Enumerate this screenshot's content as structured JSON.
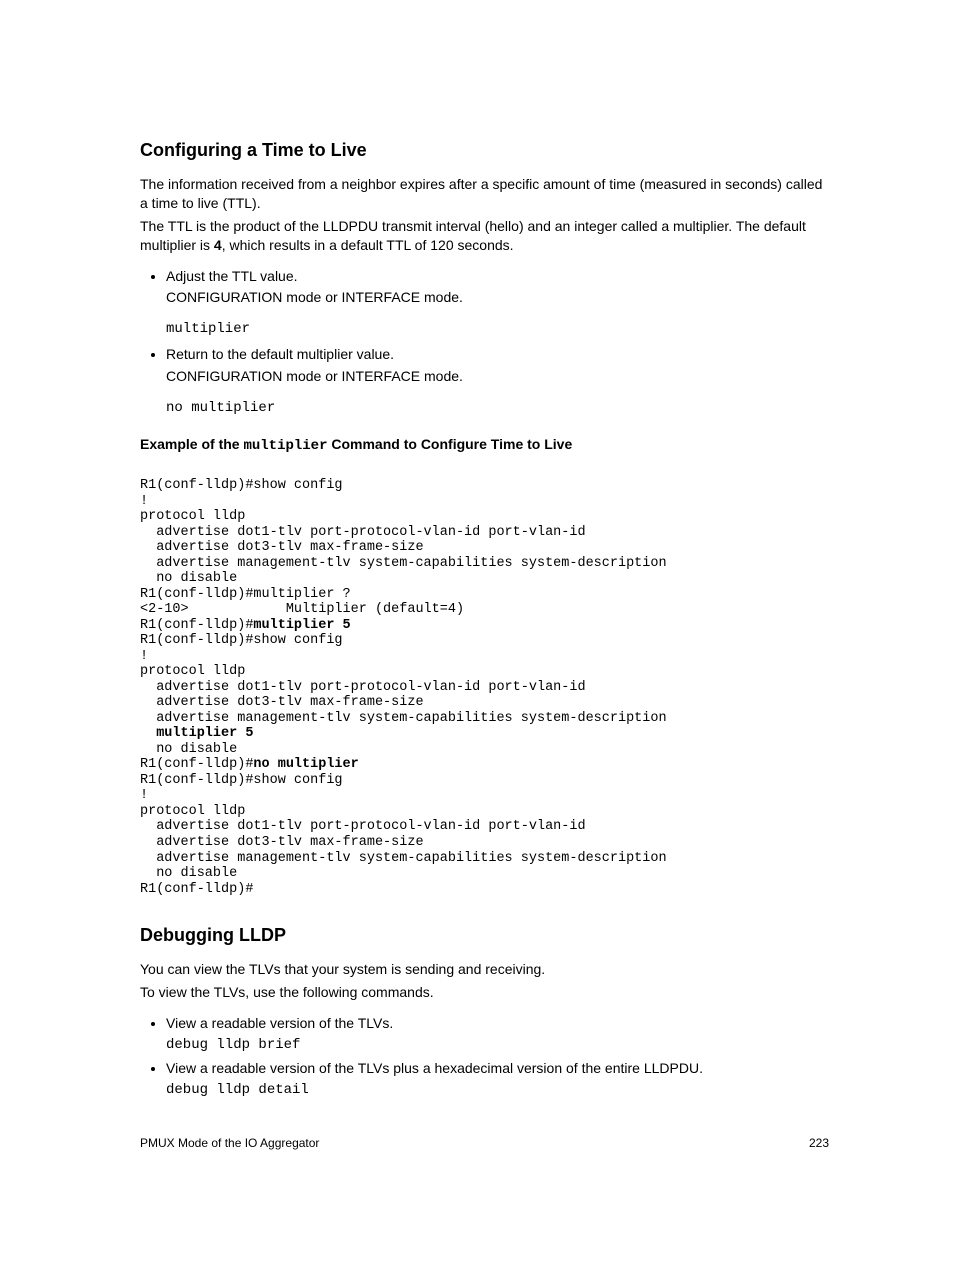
{
  "section1": {
    "heading": "Configuring a Time to Live",
    "p1": "The information received from a neighbor expires after a specific amount of time (measured in seconds) called a time to live (TTL).",
    "p2a": "The TTL is the product of the LLDPDU transmit interval (hello) and an integer called a multiplier. The default multiplier is ",
    "p2bold": "4",
    "p2b": ", which results in a default TTL of 120 seconds.",
    "bullet1": "Adjust the TTL value.",
    "sub1": "CONFIGURATION mode or INTERFACE mode.",
    "code1": "multiplier",
    "bullet2": "Return to the default multiplier value.",
    "sub2": "CONFIGURATION mode or INTERFACE mode.",
    "code2": "no multiplier",
    "example_label_a": "Example of the ",
    "example_code": "multiplier",
    "example_label_b": " Command to Configure Time to Live",
    "pre1": "R1(conf-lldp)#show config\n!\nprotocol lldp\n  advertise dot1-tlv port-protocol-vlan-id port-vlan-id\n  advertise dot3-tlv max-frame-size\n  advertise management-tlv system-capabilities system-description\n  no disable\nR1(conf-lldp)#multiplier ?\n<2-10>            Multiplier (default=4)\nR1(conf-lldp)#",
    "pre1_bold": "multiplier 5",
    "pre2": "R1(conf-lldp)#show config\n!\nprotocol lldp\n  advertise dot1-tlv port-protocol-vlan-id port-vlan-id\n  advertise dot3-tlv max-frame-size\n  advertise management-tlv system-capabilities system-description",
    "pre2_bold": "  multiplier 5",
    "pre3a": "  no disable\nR1(conf-lldp)#",
    "pre3_bold": "no multiplier",
    "pre3b": "R1(conf-lldp)#show config\n!\nprotocol lldp\n  advertise dot1-tlv port-protocol-vlan-id port-vlan-id\n  advertise dot3-tlv max-frame-size\n  advertise management-tlv system-capabilities system-description\n  no disable\nR1(conf-lldp)#"
  },
  "section2": {
    "heading": "Debugging LLDP",
    "p1": "You can view the TLVs that your system is sending and receiving.",
    "p2": "To view the TLVs, use the following commands.",
    "bullet1": "View a readable version of the TLVs.",
    "code1": "debug lldp brief",
    "bullet2": "View a readable version of the TLVs plus a hexadecimal version of the entire LLDPDU.",
    "code2": "debug lldp detail"
  },
  "footer": {
    "left": "PMUX Mode of the IO Aggregator",
    "right": "223"
  }
}
